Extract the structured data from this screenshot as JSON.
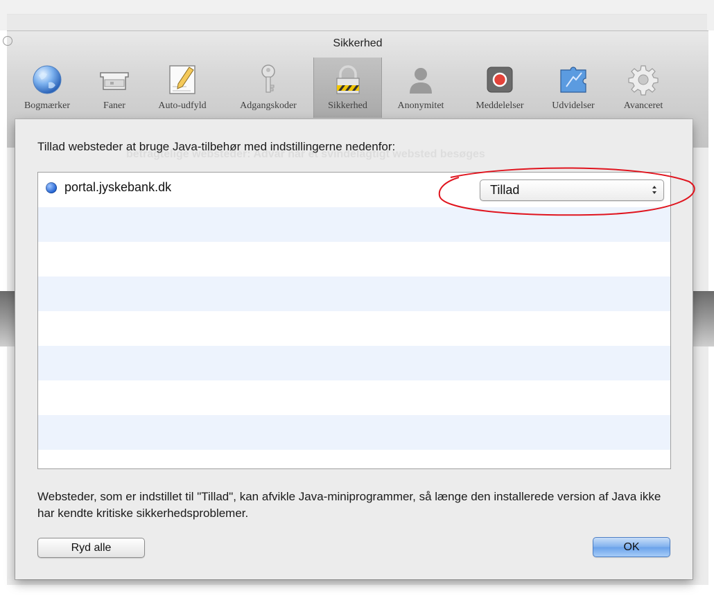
{
  "window": {
    "title": "Sikkerhed"
  },
  "toolbar": {
    "items": [
      {
        "label": "Bogmærker",
        "icon": "globe-icon"
      },
      {
        "label": "Faner",
        "icon": "tabs-icon"
      },
      {
        "label": "Auto-udfyld",
        "icon": "pencil-form-icon"
      },
      {
        "label": "Adgangskoder",
        "icon": "key-icon"
      },
      {
        "label": "Sikkerhed",
        "icon": "padlock-icon",
        "selected": true
      },
      {
        "label": "Anonymitet",
        "icon": "person-silhouette-icon"
      },
      {
        "label": "Meddelelser",
        "icon": "notification-icon"
      },
      {
        "label": "Udvidelser",
        "icon": "puzzle-extension-icon"
      },
      {
        "label": "Avanceret",
        "icon": "gear-icon"
      }
    ]
  },
  "background": {
    "ghost_text": "betragtelige websteder:     Advar når et svindelagtigt websted besøges"
  },
  "sheet": {
    "heading": "Tillad websteder at bruge Java-tilbehør med indstillingerne nedenfor:",
    "sites": [
      {
        "name": "portal.jyskebank.dk",
        "permission": "Tillad"
      }
    ],
    "info": "Websteder, som er indstillet til \"Tillad\", kan afvikle Java-miniprogrammer, så længe den installerede version af Java ikke har kendte kritiske sikkerhedsproblemer.",
    "clear_button": "Ryd alle",
    "ok_button": "OK"
  },
  "colors": {
    "highlight_ellipse": "#e0141e",
    "row_stripe": "#edf3fd",
    "ok_button": "#7fb0ee"
  }
}
